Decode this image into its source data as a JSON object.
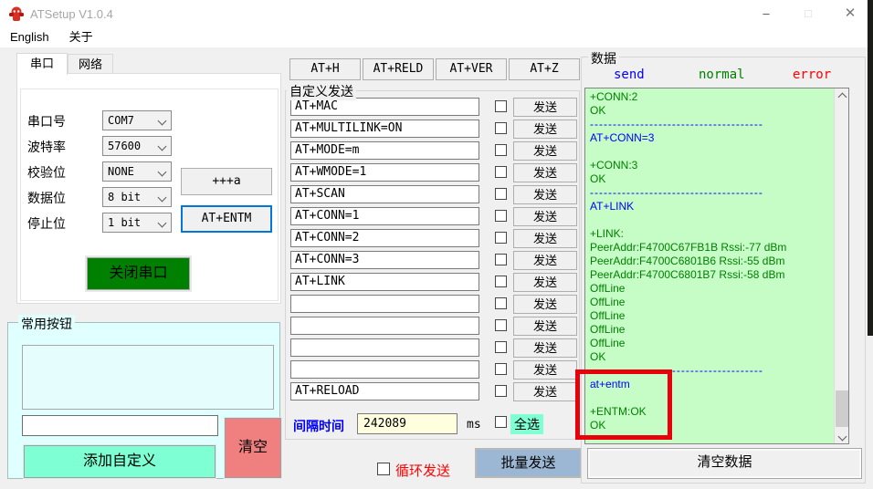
{
  "window": {
    "title": "ATSetup V1.0.4",
    "minimize_glyph": "–",
    "maximize_glyph": "□",
    "close_glyph": "✕"
  },
  "menu": {
    "items": [
      {
        "label": "English"
      },
      {
        "label": "关于"
      }
    ]
  },
  "serial_panel": {
    "tabs": [
      {
        "label": "串口",
        "active": true
      },
      {
        "label": "网络",
        "active": false
      }
    ],
    "fields": [
      {
        "label": "串口号",
        "value": "COM7"
      },
      {
        "label": "波特率",
        "value": "57600"
      },
      {
        "label": "校验位",
        "value": "NONE"
      },
      {
        "label": "数据位",
        "value": "8 bit"
      },
      {
        "label": "停止位",
        "value": "1 bit"
      }
    ],
    "plus_a_button": "+++a",
    "at_entm_button": "AT+ENTM",
    "close_serial_button": "关闭串口"
  },
  "common_buttons": {
    "title": "常用按钮",
    "input_value": "",
    "add_custom_button": "添加自定义",
    "clear_button": "清空"
  },
  "quick_commands": {
    "buttons": [
      "AT+H",
      "AT+RELD",
      "AT+VER",
      "AT+Z"
    ]
  },
  "custom_send": {
    "title": "自定义发送",
    "send_button_label": "发送",
    "rows": [
      {
        "command": "AT+MAC",
        "checked": false
      },
      {
        "command": "AT+MULTILINK=ON",
        "checked": false
      },
      {
        "command": "AT+MODE=m",
        "checked": false
      },
      {
        "command": "AT+WMODE=1",
        "checked": false
      },
      {
        "command": "AT+SCAN",
        "checked": false
      },
      {
        "command": "AT+CONN=1",
        "checked": false
      },
      {
        "command": "AT+CONN=2",
        "checked": false
      },
      {
        "command": "AT+CONN=3",
        "checked": false
      },
      {
        "command": "AT+LINK",
        "checked": false
      },
      {
        "command": "",
        "checked": false
      },
      {
        "command": "",
        "checked": false
      },
      {
        "command": "",
        "checked": false
      },
      {
        "command": "",
        "checked": false
      },
      {
        "command": "AT+RELOAD",
        "checked": false
      }
    ],
    "interval_label": "间隔时间",
    "interval_value": "242089",
    "interval_unit": "ms",
    "select_all_label": "全选",
    "select_all_checked": false,
    "loop_send_label": "循环发送",
    "loop_send_checked": false,
    "batch_send_button": "批量发送"
  },
  "data_panel": {
    "title": "数据",
    "legend": [
      {
        "label": "send",
        "color_key": "send_blue"
      },
      {
        "label": "normal",
        "color_key": "normal_green"
      },
      {
        "label": "error",
        "color_key": "error_red"
      }
    ],
    "log": [
      {
        "text": "+CONN:2",
        "kind": "normal"
      },
      {
        "text": "OK",
        "kind": "normal"
      },
      {
        "text": "--------------------------------------",
        "kind": "separator"
      },
      {
        "text": "AT+CONN=3",
        "kind": "send"
      },
      {
        "text": "",
        "kind": "blank"
      },
      {
        "text": "+CONN:3",
        "kind": "normal"
      },
      {
        "text": "OK",
        "kind": "normal"
      },
      {
        "text": "--------------------------------------",
        "kind": "separator"
      },
      {
        "text": "AT+LINK",
        "kind": "send"
      },
      {
        "text": "",
        "kind": "blank"
      },
      {
        "text": "+LINK:",
        "kind": "normal"
      },
      {
        "text": "PeerAddr:F4700C67FB1B Rssi:-77 dBm",
        "kind": "normal"
      },
      {
        "text": "PeerAddr:F4700C6801B6 Rssi:-55 dBm",
        "kind": "normal"
      },
      {
        "text": "PeerAddr:F4700C6801B7 Rssi:-58 dBm",
        "kind": "normal"
      },
      {
        "text": "OffLine",
        "kind": "normal"
      },
      {
        "text": "OffLine",
        "kind": "normal"
      },
      {
        "text": "OffLine",
        "kind": "normal"
      },
      {
        "text": "OffLine",
        "kind": "normal"
      },
      {
        "text": "OffLine",
        "kind": "normal"
      },
      {
        "text": "OK",
        "kind": "normal"
      },
      {
        "text": "--------------------------------------",
        "kind": "separator"
      },
      {
        "text": "at+entm",
        "kind": "send"
      },
      {
        "text": "",
        "kind": "blank"
      },
      {
        "text": "+ENTM:OK",
        "kind": "normal"
      },
      {
        "text": "OK",
        "kind": "normal"
      }
    ],
    "clear_data_button": "清空数据"
  },
  "colors": {
    "green_btn": "#008000",
    "mint": "#7fffd4",
    "salmon": "#f08080",
    "panel_cyan": "#e0ffff",
    "log_bg": "#c6fcc6",
    "send_blue": "#0000ff",
    "normal_green": "#008000",
    "error_red": "#ff0000",
    "annot_red": "#e8000a",
    "batch_blue": "#9cb7d3",
    "pale_yellow": "#ffffe0",
    "focus_blue": "#0078d7"
  }
}
